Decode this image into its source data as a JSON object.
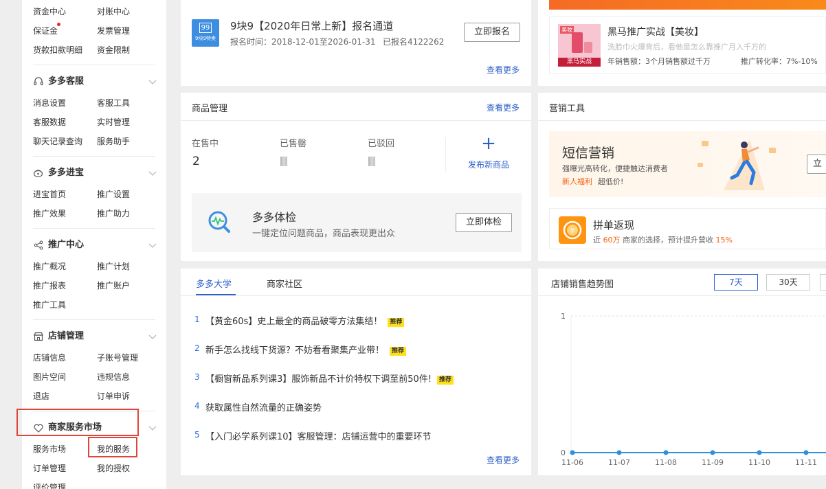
{
  "sidebar": {
    "top_rows": [
      [
        "资金中心",
        "对账中心"
      ],
      [
        "保证金",
        "发票管理"
      ],
      [
        "货款扣款明细",
        "资金限制"
      ]
    ],
    "sections": [
      {
        "title": "多多客服",
        "icon": "headset-icon",
        "items": [
          [
            "消息设置",
            "客服工具"
          ],
          [
            "客服数据",
            "实时管理"
          ],
          [
            "聊天记录查询",
            "服务助手"
          ]
        ]
      },
      {
        "title": "多多进宝",
        "icon": "treasure-icon",
        "items": [
          [
            "进宝首页",
            "推广设置"
          ],
          [
            "推广效果",
            "推广助力"
          ]
        ]
      },
      {
        "title": "推广中心",
        "icon": "share-icon",
        "items": [
          [
            "推广概况",
            "推广计划"
          ],
          [
            "推广报表",
            "推广账户"
          ],
          [
            "推广工具",
            ""
          ]
        ]
      },
      {
        "title": "店铺管理",
        "icon": "store-icon",
        "items": [
          [
            "店铺信息",
            "子账号管理"
          ],
          [
            "图片空间",
            "违规信息"
          ],
          [
            "退店",
            "订单申诉"
          ]
        ]
      },
      {
        "title": "商家服务市场",
        "icon": "heart-icon",
        "items": [
          [
            "服务市场",
            "我的服务"
          ],
          [
            "订单管理",
            "我的授权"
          ],
          [
            "评价管理",
            ""
          ]
        ]
      }
    ]
  },
  "signup": {
    "logo_top": "99",
    "logo_bottom": "9块9特卖",
    "title": "9块9【2020年日常上新】报名通道",
    "time": "报名时间：2018-12-01至2026-01-31",
    "count": "已报名4122262",
    "button": "立即报名",
    "more": "查看更多"
  },
  "promo": {
    "thumb_tag": "美妆",
    "thumb_caption": "黑马实战",
    "title": "黑马推广实战【美妆】",
    "desc": "洗脸巾火爆背后，看他是怎么靠推广月入千万的",
    "stat1": "年销售额：3个月销售额过千万",
    "stat2": "推广转化率：7%-10%"
  },
  "goods": {
    "title": "商品管理",
    "more": "查看更多",
    "on_sale_label": "在售中",
    "on_sale_value": "2",
    "sold_out_label": "已售罄",
    "rejected_label": "已驳回",
    "publish_label": "发布新商品",
    "publish_icon": "+",
    "check_title": "多多体检",
    "check_desc": "一键定位问题商品，商品表现更出众",
    "check_button": "立即体检"
  },
  "marketing": {
    "title": "营销工具",
    "sms_title": "短信营销",
    "sms_desc": "强曝光高转化，便捷触达消费者",
    "sms_newbie": "新人福利",
    "sms_price": "超低价!",
    "sms_button": "立",
    "cashback_title": "拼单返现",
    "cashback_prefix": "近",
    "cashback_num": "60万",
    "cashback_mid": "商家的选择，预计提升营收",
    "cashback_pct": "15%"
  },
  "university": {
    "tabs": [
      "多多大学",
      "商家社区"
    ],
    "items": [
      {
        "num": "1",
        "text": "【黄金60s】史上最全的商品破零方法集结！",
        "tag": "推荐"
      },
      {
        "num": "2",
        "text": "新手怎么找线下货源？不妨看看聚集产业带！",
        "tag": "推荐"
      },
      {
        "num": "3",
        "text": "【橱窗新品系列课3】服饰新品不计价特权下调至前50件!",
        "tag": "推荐"
      },
      {
        "num": "4",
        "text": "获取属性自然流量的正确姿势",
        "tag": ""
      },
      {
        "num": "5",
        "text": "【入门必学系列课10】客服管理：店铺运营中的重要环节",
        "tag": ""
      }
    ],
    "more": "查看更多"
  },
  "trend": {
    "title": "店铺销售趋势图",
    "ranges": [
      "7天",
      "30天"
    ],
    "selected_range": "7天"
  },
  "chart_data": {
    "type": "line",
    "x": [
      "11-06",
      "11-07",
      "11-08",
      "11-09",
      "11-10",
      "11-11"
    ],
    "series": [
      {
        "values": [
          0,
          0,
          0,
          0,
          0,
          0
        ]
      }
    ],
    "ylim": [
      0,
      1
    ],
    "yticks": [
      "0",
      "1"
    ],
    "color": "#2f8fe0"
  }
}
